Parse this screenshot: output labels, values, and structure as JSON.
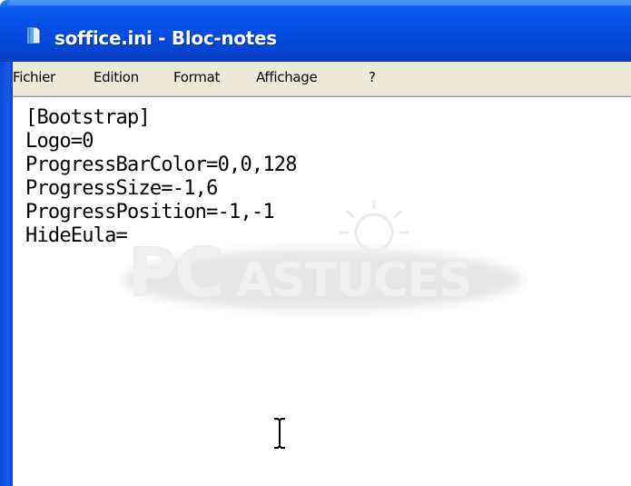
{
  "window": {
    "title": "soffice.ini - Bloc-notes",
    "app_icon": "notepad-icon"
  },
  "menubar": {
    "items": [
      "Fichier",
      "Edition",
      "Format",
      "Affichage",
      "?"
    ]
  },
  "editor": {
    "lines": [
      "[Bootstrap]",
      "Logo=0",
      "ProgressBarColor=0,0,128",
      "ProgressSize=-1,6",
      "ProgressPosition=-1,-1",
      "HideEula="
    ]
  },
  "watermark": {
    "text_big": "PC",
    "text_small": "ASTUCES"
  },
  "colors": {
    "titlebar": "#0550e6",
    "menubar": "#ece9d8",
    "editor_bg": "#ffffff"
  }
}
